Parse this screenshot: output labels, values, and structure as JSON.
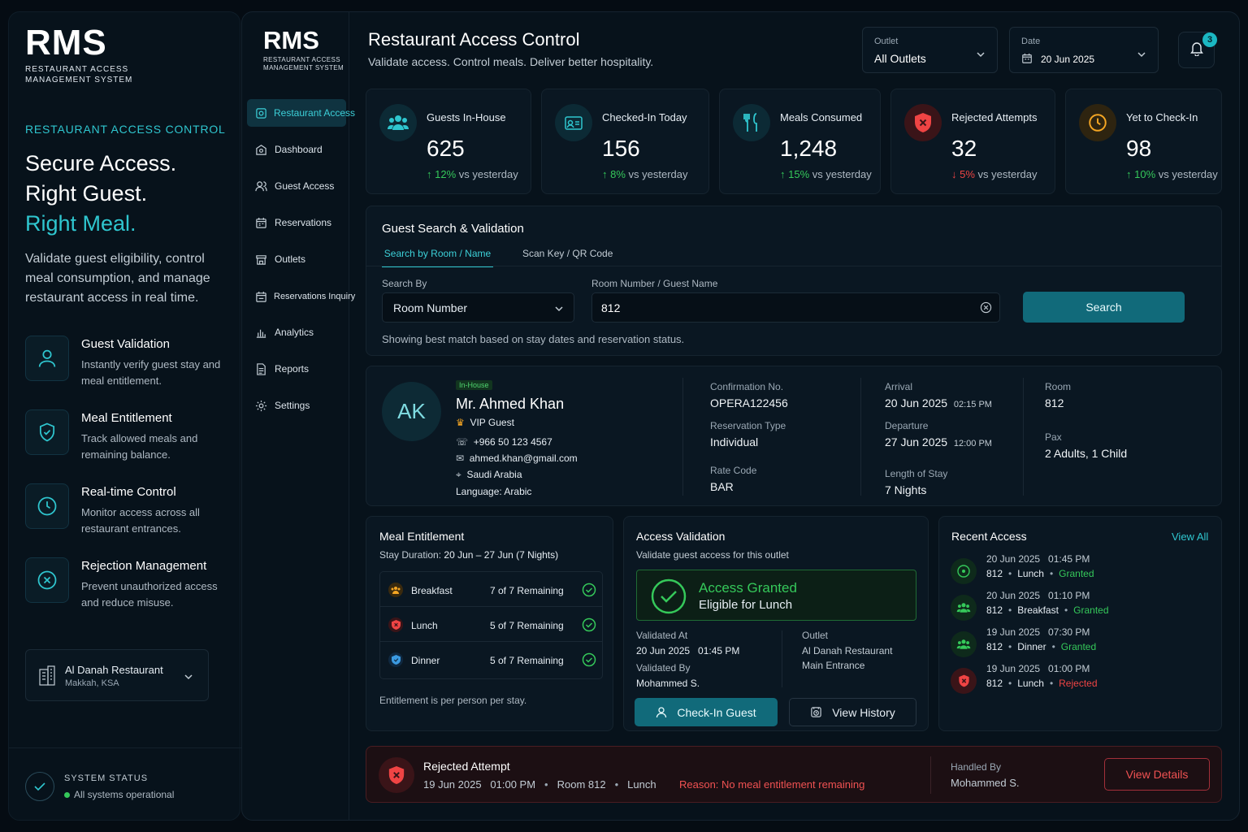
{
  "promo": {
    "logo": "RMS",
    "logo_sub_1": "RESTAURANT ACCESS",
    "logo_sub_2": "MANAGEMENT SYSTEM",
    "kicker": "RESTAURANT ACCESS CONTROL",
    "headline_1": "Secure Access.",
    "headline_2": "Right Guest.",
    "headline_3": "Right Meal.",
    "description": "Validate guest eligibility, control meal consumption, and manage restaurant access in real time.",
    "features": [
      {
        "title": "Guest Validation",
        "desc": "Instantly verify guest stay and meal entitlement.",
        "icon": "user-icon"
      },
      {
        "title": "Meal Entitlement",
        "desc": "Track allowed meals and remaining balance.",
        "icon": "shield-check-icon"
      },
      {
        "title": "Real-time Control",
        "desc": "Monitor access across all restaurant entrances.",
        "icon": "clock-icon"
      },
      {
        "title": "Rejection Management",
        "desc": "Prevent unauthorized access and reduce misuse.",
        "icon": "x-circle-icon"
      }
    ],
    "outlet": {
      "name": "Al Danah Restaurant",
      "location": "Makkah, KSA"
    },
    "system_status": {
      "label": "SYSTEM STATUS",
      "value": "All systems operational"
    }
  },
  "sidebar": {
    "logo": "RMS",
    "logo_sub_1": "RESTAURANT ACCESS",
    "logo_sub_2": "MANAGEMENT SYSTEM",
    "items": [
      {
        "label": "Restaurant Access",
        "icon": "shield-lock-icon",
        "active": true
      },
      {
        "label": "Dashboard",
        "icon": "dashboard-icon"
      },
      {
        "label": "Guest Access",
        "icon": "users-icon"
      },
      {
        "label": "Reservations",
        "icon": "calendar-icon"
      },
      {
        "label": "Outlets",
        "icon": "store-icon"
      },
      {
        "label": "Reservations Inquiry",
        "icon": "calendar-search-icon"
      },
      {
        "label": "Analytics",
        "icon": "bar-chart-icon"
      },
      {
        "label": "Reports",
        "icon": "document-icon"
      },
      {
        "label": "Settings",
        "icon": "gear-icon"
      }
    ]
  },
  "header": {
    "title": "Restaurant Access Control",
    "subtitle": "Validate access. Control meals. Deliver better hospitality.",
    "outlet_label": "Outlet",
    "outlet_value": "All Outlets",
    "date_label": "Date",
    "date_value": "20 Jun 2025",
    "notification_count": "3"
  },
  "kpis": [
    {
      "label": "Guests In-House",
      "value": "625",
      "change": "12%",
      "direction": "up",
      "suffix": "vs yesterday",
      "color": "#2fc6cf"
    },
    {
      "label": "Checked-In Today",
      "value": "156",
      "change": "8%",
      "direction": "up",
      "suffix": "vs yesterday",
      "color": "#2fc6cf"
    },
    {
      "label": "Meals Consumed",
      "value": "1,248",
      "change": "15%",
      "direction": "up",
      "suffix": "vs yesterday",
      "color": "#2fc6cf"
    },
    {
      "label": "Rejected Attempts",
      "value": "32",
      "change": "5%",
      "direction": "down",
      "suffix": "vs yesterday",
      "color": "#ef4444"
    },
    {
      "label": "Yet to Check-In",
      "value": "98",
      "change": "10%",
      "direction": "up",
      "suffix": "vs yesterday",
      "color": "#f5a623"
    }
  ],
  "search": {
    "title": "Guest Search & Validation",
    "tab_room": "Search by Room / Name",
    "tab_scan": "Scan Key / QR Code",
    "search_by_label": "Search By",
    "search_by_value": "Room Number",
    "query_label": "Room Number / Guest Name",
    "query_value": "812",
    "button": "Search",
    "hint": "Showing best match based on stay dates and reservation status."
  },
  "guest": {
    "initials": "AK",
    "badge": "In-House",
    "name": "Mr. Ahmed Khan",
    "tier": "VIP Guest",
    "phone": "+966 50 123 4567",
    "email": "ahmed.khan@gmail.com",
    "country": "Saudi Arabia",
    "language": "Language: Arabic",
    "confirmation_label": "Confirmation No.",
    "confirmation_value": "OPERA122456",
    "res_type_label": "Reservation Type",
    "res_type_value": "Individual",
    "rate_label": "Rate Code",
    "rate_value": "BAR",
    "arrival_label": "Arrival",
    "arrival_date": "20 Jun 2025",
    "arrival_time": "02:15 PM",
    "departure_label": "Departure",
    "departure_date": "27 Jun 2025",
    "departure_time": "12:00 PM",
    "los_label": "Length of Stay",
    "los_value": "7 Nights",
    "room_label": "Room",
    "room_value": "812",
    "pax_label": "Pax",
    "pax_value": "2 Adults, 1 Child"
  },
  "meals": {
    "title": "Meal Entitlement",
    "stay_label": "Stay Duration:",
    "stay_value": "20 Jun – 27 Jun (7 Nights)",
    "rows": [
      {
        "name": "Breakfast",
        "remaining": "7 of 7 Remaining",
        "icon": "breakfast-icon",
        "color": "#f5a623"
      },
      {
        "name": "Lunch",
        "remaining": "5 of 7 Remaining",
        "icon": "lunch-icon",
        "color": "#ef4444"
      },
      {
        "name": "Dinner",
        "remaining": "5 of 7 Remaining",
        "icon": "dinner-icon",
        "color": "#3b9ae1"
      }
    ],
    "footer": "Entitlement is per person per stay."
  },
  "validation": {
    "title": "Access Validation",
    "subtitle": "Validate guest access for this outlet",
    "status": "Access Granted",
    "status_detail": "Eligible for Lunch",
    "validated_at_label": "Validated At",
    "validated_at_value": "20 Jun 2025   01:45 PM",
    "validated_by_label": "Validated By",
    "validated_by_value": "Mohammed S.",
    "outlet_label": "Outlet",
    "outlet_line1": "Al Danah Restaurant",
    "outlet_line2": "Main Entrance",
    "checkin_button": "Check-In Guest",
    "history_button": "View History"
  },
  "recent": {
    "title": "Recent Access",
    "view_all": "View All",
    "items": [
      {
        "time": "20 Jun 2025   01:45 PM",
        "room": "812",
        "meal": "Lunch",
        "status": "Granted",
        "ok": true
      },
      {
        "time": "20 Jun 2025   01:10 PM",
        "room": "812",
        "meal": "Breakfast",
        "status": "Granted",
        "ok": true
      },
      {
        "time": "19 Jun 2025   07:30 PM",
        "room": "812",
        "meal": "Dinner",
        "status": "Granted",
        "ok": true
      },
      {
        "time": "19 Jun 2025   01:00 PM",
        "room": "812",
        "meal": "Lunch",
        "status": "Rejected",
        "ok": false
      }
    ]
  },
  "rejected": {
    "title": "Rejected Attempt",
    "time": "19 Jun 2025   01:00 PM",
    "room": "Room 812",
    "meal": "Lunch",
    "reason": "Reason: No meal entitlement remaining",
    "handled_label": "Handled By",
    "handled_value": "Mohammed S.",
    "button": "View Details"
  }
}
